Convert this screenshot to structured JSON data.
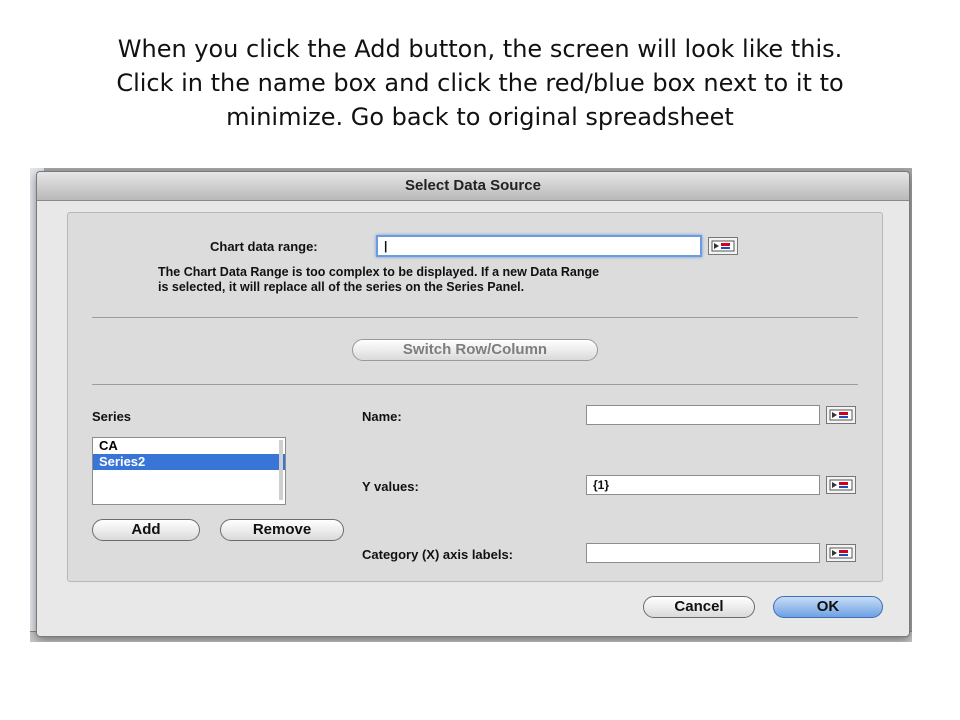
{
  "caption": {
    "line1": "When you click the Add button, the screen will look like this.",
    "line2": "Click in the name box and click the red/blue box next to it to",
    "line3": "minimize.  Go back to original spreadsheet"
  },
  "dialog": {
    "title": "Select Data Source",
    "chart_range": {
      "label": "Chart data range:",
      "value": "|",
      "note_line1": "The Chart Data Range is too complex to be displayed. If a new Data Range",
      "note_line2": "is selected, it will replace all of the series on the Series Panel."
    },
    "switch_button": "Switch Row/Column",
    "series": {
      "label": "Series",
      "items": [
        {
          "label": "CA",
          "selected": false
        },
        {
          "label": "Series2",
          "selected": true
        }
      ],
      "add_button": "Add",
      "remove_button": "Remove"
    },
    "fields": {
      "name_label": "Name:",
      "name_value": "",
      "yvalues_label": "Y values:",
      "yvalues_value": "{1}",
      "category_label": "Category (X) axis labels:",
      "category_value": ""
    },
    "cancel_button": "Cancel",
    "ok_button": "OK"
  },
  "colors": {
    "selection": "#3875d7",
    "default_button": "#6fa0e4",
    "focus_ring": "#6b9be0",
    "range_icon_red": "#d0021b",
    "range_icon_blue": "#1d4fb8"
  },
  "icons": {
    "range_selector": "collapse-dialog-icon"
  }
}
